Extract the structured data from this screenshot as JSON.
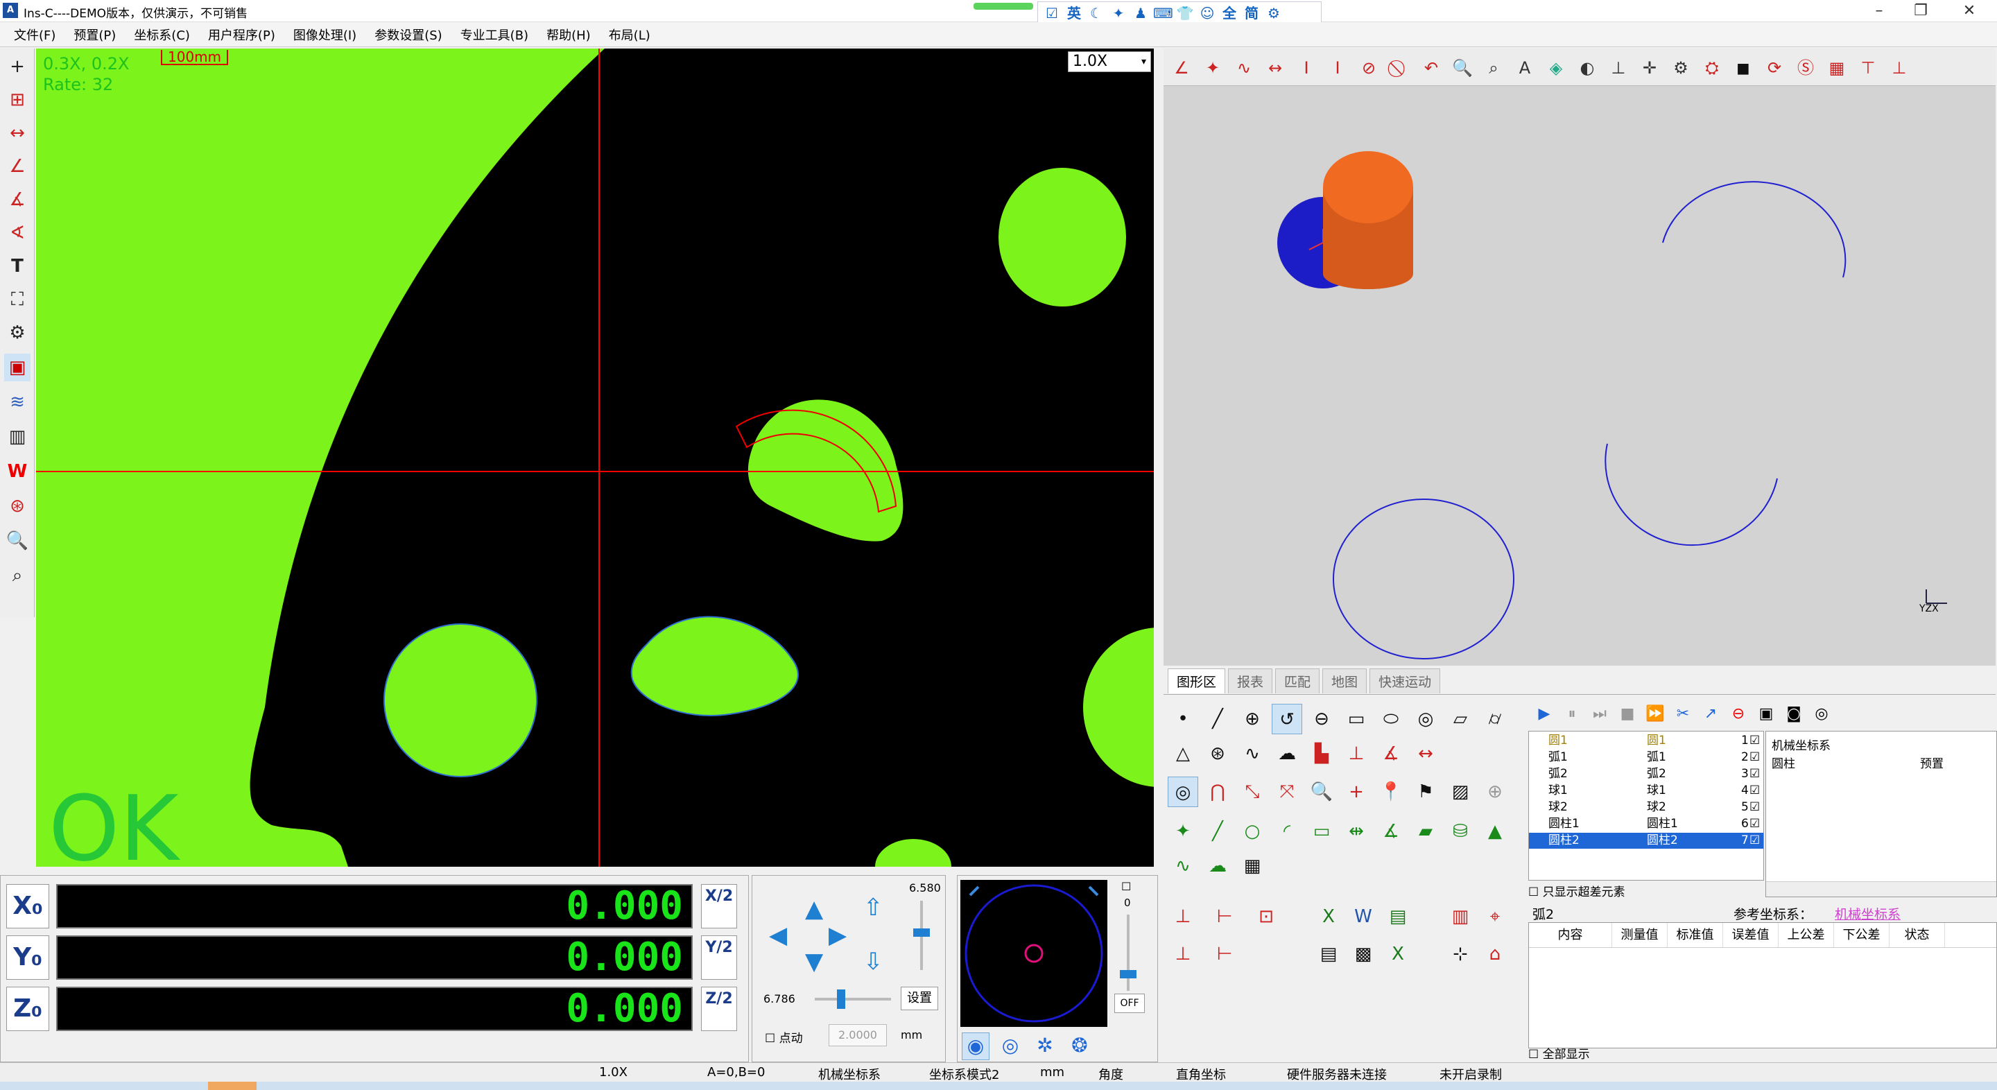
{
  "window": {
    "title": "Ins-C----DEMO版本，仅供演示，不可销售"
  },
  "ime": {
    "items": [
      "☑",
      "英",
      "☾",
      "✦",
      "♟",
      "⌨",
      "👕",
      "☺",
      "全",
      "简",
      "⚙"
    ]
  },
  "menu": {
    "items": [
      "文件(F)",
      "预置(P)",
      "坐标系(C)",
      "用户程序(P)",
      "图像处理(I)",
      "参数设置(S)",
      "专业工具(B)",
      "帮助(H)",
      "布局(L)"
    ]
  },
  "camera": {
    "info_line1": "0.3X, 0.2X",
    "info_line2": "Rate: 32",
    "scale_label": "100mm",
    "zoom": "1.0X",
    "status": "OK",
    "colors": {
      "part": "#7cf31a",
      "background": "#000000",
      "crosshair": "#ff0000"
    }
  },
  "view_tabs": [
    "图形区",
    "报表",
    "匹配",
    "地图",
    "快速运动"
  ],
  "elements": [
    {
      "index": "1",
      "name": "圆1",
      "type": "圆1",
      "checked": true
    },
    {
      "index": "2",
      "name": "弧1",
      "type": "弧1",
      "checked": true
    },
    {
      "index": "3",
      "name": "弧2",
      "type": "弧2",
      "checked": true
    },
    {
      "index": "4",
      "name": "球1",
      "type": "球1",
      "checked": true
    },
    {
      "index": "5",
      "name": "球2",
      "type": "球2",
      "checked": true
    },
    {
      "index": "6",
      "name": "圆柱1",
      "type": "圆柱1",
      "checked": true
    },
    {
      "index": "7",
      "name": "圆柱2",
      "type": "圆柱2",
      "checked": true
    }
  ],
  "coord_panel": {
    "title": "机械坐标系",
    "row_label": "圆柱",
    "row_value": "预置"
  },
  "only_exceed_label": "只显示超差元素",
  "param": {
    "element": "弧2",
    "ref_label": "参考坐标系：",
    "ref_value": "机械坐标系",
    "columns": [
      "内容",
      "测量值",
      "标准值",
      "误差值",
      "上公差",
      "下公差",
      "状态"
    ],
    "show_all_label": "全部显示"
  },
  "dro": {
    "x_label": "X₀",
    "x_value": "0.000",
    "x_half": "X/2",
    "y_label": "Y₀",
    "y_value": "0.000",
    "y_half": "Y/2",
    "z_label": "Z₀",
    "z_value": "0.000",
    "z_half": "Z/2"
  },
  "jog": {
    "speed_top": "6.580",
    "speed_bottom": "6.786",
    "set_label": "设置",
    "step_label": "点动",
    "step_value": "2.0000",
    "step_unit": "mm"
  },
  "navigator": {
    "slider_value": "0",
    "off_label": "OFF"
  },
  "status": {
    "zoom": "1.0X",
    "ab": "A=0,B=0",
    "coord_system": "机械坐标系",
    "coord_mode": "坐标系模式2",
    "unit": "mm",
    "angle": "角度",
    "coord_type": "直角坐标",
    "hardware": "硬件服务器未连接",
    "recording": "未开启录制"
  },
  "colors": {
    "dro_text": "#19e319",
    "accent_blue": "#1f66d6",
    "view3d_bg": "#d3d3d3"
  }
}
